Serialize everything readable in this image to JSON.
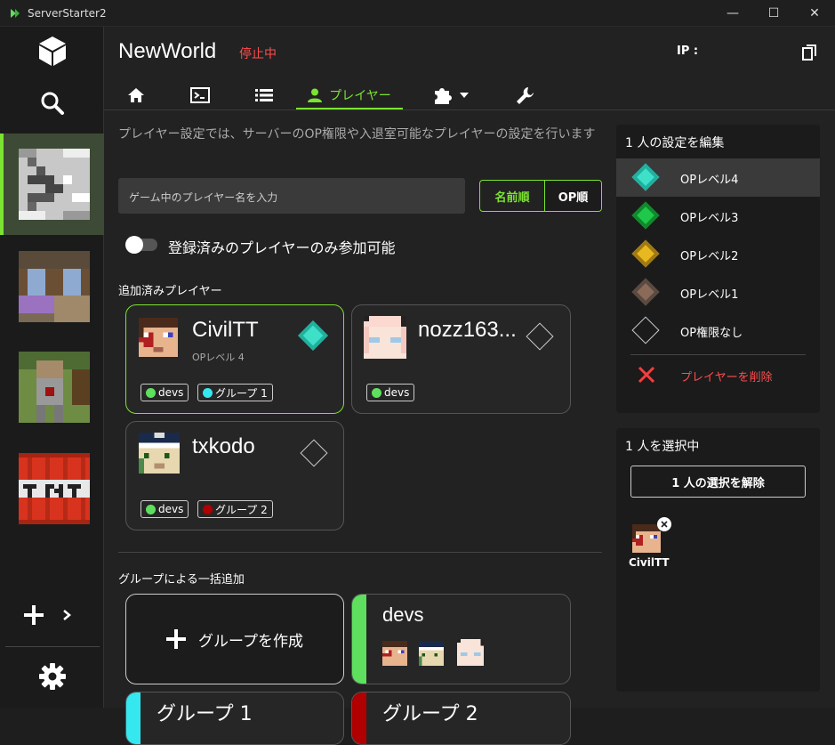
{
  "window": {
    "title": "ServerStarter2",
    "controls": [
      "—",
      "☐",
      "✕"
    ]
  },
  "sidebar": {
    "add_icon": "plus-icon",
    "expand_icon": "chevron-right-icon",
    "settings_icon": "gear-icon"
  },
  "header": {
    "world_name": "NewWorld",
    "status": "停止中",
    "ip_label": "IP :"
  },
  "tabs": [
    {
      "name": "home-tab"
    },
    {
      "name": "console-tab"
    },
    {
      "name": "list-tab"
    },
    {
      "name": "player-tab",
      "label": "プレイヤー",
      "active": true
    },
    {
      "name": "addons-tab"
    },
    {
      "name": "settings-tab"
    }
  ],
  "player": {
    "description": "プレイヤー設定では、サーバーのOP権限や入退室可能なプレイヤーの設定を行います",
    "name_input_placeholder": "ゲーム中のプレイヤー名を入力",
    "sort_name": "名前順",
    "sort_op": "OP順",
    "whitelist_toggle_label": "登録済みのプレイヤーのみ参加可能",
    "whitelist_enabled": false,
    "added_heading": "追加済みプレイヤー",
    "players": [
      {
        "name": "CivilTT",
        "op_text": "OPレベル 4",
        "op_level": 4,
        "selected": true,
        "groups": [
          {
            "name": "devs",
            "color": "#5ee05e"
          },
          {
            "name": "グループ 1",
            "color": "#35e8f0"
          }
        ]
      },
      {
        "name": "nozz163...",
        "op_text": "",
        "op_level": 0,
        "selected": false,
        "groups": [
          {
            "name": "devs",
            "color": "#5ee05e"
          }
        ]
      },
      {
        "name": "txkodo",
        "op_text": "",
        "op_level": 0,
        "selected": false,
        "groups": [
          {
            "name": "devs",
            "color": "#5ee05e"
          },
          {
            "name": "グループ 2",
            "color": "#b00000"
          }
        ]
      }
    ],
    "group_heading": "グループによる一括追加",
    "create_group_label": "グループを作成",
    "groups": [
      {
        "name": "devs",
        "color": "#5ee05e"
      },
      {
        "name": "グループ 1",
        "color": "#35e8f0"
      },
      {
        "name": "グループ 2",
        "color": "#b00000"
      }
    ]
  },
  "edit_panel": {
    "title": "1 人の設定を編集",
    "items": [
      {
        "label": "OPレベル4",
        "color": "#3fe0c8",
        "highlight": true
      },
      {
        "label": "OPレベル3",
        "color": "#1fc84a",
        "highlight": false
      },
      {
        "label": "OPレベル2",
        "color": "#e8b820",
        "highlight": false
      },
      {
        "label": "OPレベル1",
        "color": "#8a6a58",
        "highlight": false
      },
      {
        "label": "OP権限なし",
        "color": "",
        "highlight": false
      }
    ],
    "remove_label": "プレイヤーを削除"
  },
  "selection_panel": {
    "title": "1 人を選択中",
    "clear_label": "1 人の選択を解除",
    "selected": [
      {
        "name": "CivilTT"
      }
    ]
  },
  "colors": {
    "accent": "#7be331",
    "danger": "#ff4d4d",
    "panel": "#1b1b1b",
    "background": "#222222"
  }
}
